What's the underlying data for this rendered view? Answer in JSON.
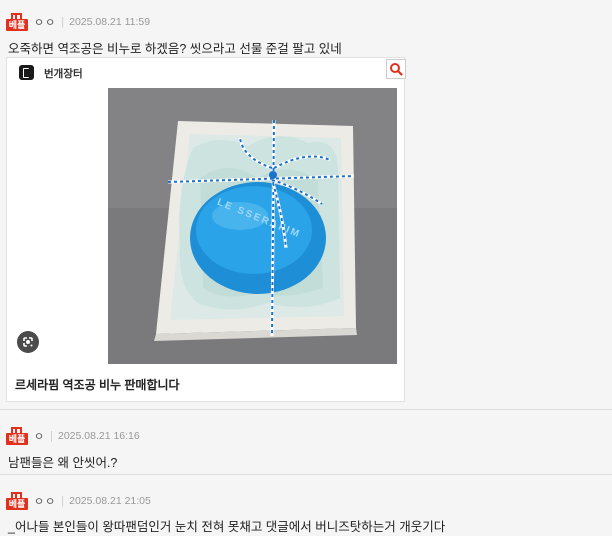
{
  "badge_label": "베플",
  "comments": [
    {
      "nickname": "ㅇㅇ",
      "date": "2025.08.21 11:59",
      "text": "오죽하면 역조공은 비누로 하겠음? 씻으라고 선물 준걸 팔고 있네",
      "link_card": {
        "site_name": "번개장터",
        "title": "르세라핌 역조공 비누 판매합니다",
        "image_text": "LE SSERAFIM"
      }
    },
    {
      "nickname": "ㅇ",
      "date": "2025.08.21 16:16",
      "text": "남팬들은 왜 안씻어.?"
    },
    {
      "nickname": "ㅇㅇ",
      "date": "2025.08.21 21:05",
      "text": "_어나들 본인들이 왕따팬덤인거 눈치 전혀 못채고 댓글에서 버니즈탓하는거 개웃기다"
    }
  ],
  "icons": {
    "badge": "best-comment-badge-icon",
    "app": "bunjang-app-icon",
    "search": "search-icon",
    "lens": "google-lens-icon"
  },
  "colors": {
    "badge_red": "#e0301e",
    "background": "#f5f5f5",
    "date_gray": "#999999"
  }
}
